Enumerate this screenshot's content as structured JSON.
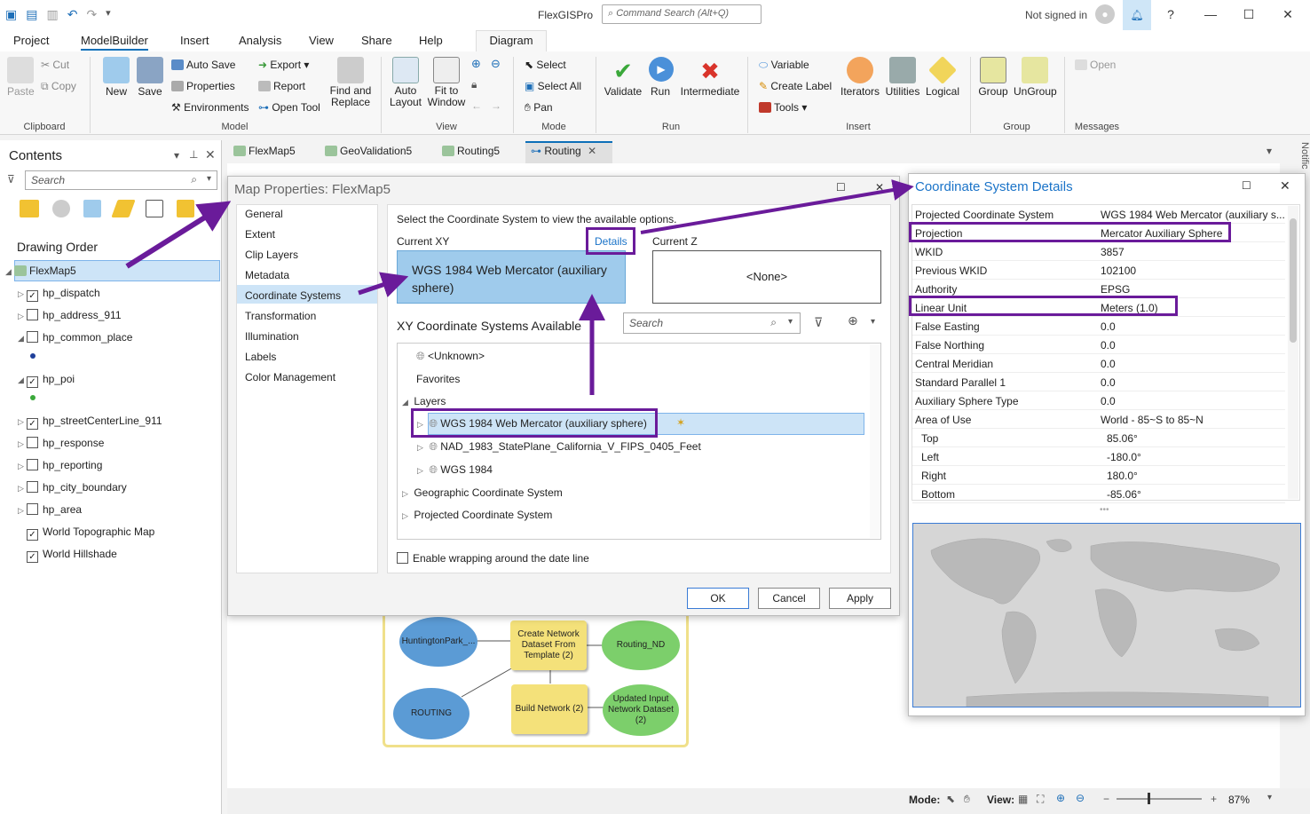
{
  "app": {
    "title": "FlexGISPro",
    "command_search_placeholder": "Command Search (Alt+Q)",
    "signin_text": "Not signed in",
    "help_glyph": "?"
  },
  "ribbon_tabs": [
    "Project",
    "ModelBuilder",
    "Insert",
    "Analysis",
    "View",
    "Share",
    "Help",
    "Diagram"
  ],
  "ribbon": {
    "clipboard": {
      "paste": "Paste",
      "cut": "Cut",
      "copy": "Copy",
      "label": "Clipboard"
    },
    "model": {
      "new": "New",
      "save": "Save",
      "auto_save": "Auto Save",
      "properties": "Properties",
      "environments": "Environments",
      "export": "Export",
      "report": "Report",
      "open_tool": "Open Tool",
      "find_replace": "Find and Replace",
      "label": "Model"
    },
    "view": {
      "auto_layout": "Auto Layout",
      "fit_window": "Fit to Window",
      "label": "View"
    },
    "mode": {
      "select": "Select",
      "select_all": "Select All",
      "pan": "Pan",
      "label": "Mode"
    },
    "run": {
      "validate": "Validate",
      "run": "Run",
      "intermediate": "Intermediate",
      "label": "Run"
    },
    "insert": {
      "variable": "Variable",
      "create_label": "Create Label",
      "tools": "Tools",
      "iterators": "Iterators",
      "utilities": "Utilities",
      "logical": "Logical",
      "label": "Insert"
    },
    "group": {
      "group": "Group",
      "ungroup": "UnGroup",
      "label": "Group"
    },
    "messages": {
      "open": "Open",
      "label": "Messages"
    }
  },
  "contents": {
    "title": "Contents",
    "search_placeholder": "Search",
    "drawing_order": "Drawing Order",
    "map_name": "FlexMap5",
    "layers": [
      {
        "name": "hp_dispatch",
        "checked": true
      },
      {
        "name": "hp_address_911",
        "checked": false
      },
      {
        "name": "hp_common_place",
        "checked": false
      },
      {
        "name": "hp_poi",
        "checked": true
      },
      {
        "name": "hp_streetCenterLine_911",
        "checked": true
      },
      {
        "name": "hp_response",
        "checked": false
      },
      {
        "name": "hp_reporting",
        "checked": false
      },
      {
        "name": "hp_city_boundary",
        "checked": false
      },
      {
        "name": "hp_area",
        "checked": false
      },
      {
        "name": "World Topographic Map",
        "checked": true
      },
      {
        "name": "World Hillshade",
        "checked": true
      }
    ]
  },
  "doc_tabs": [
    "FlexMap5",
    "GeoValidation5",
    "Routing5",
    "Routing"
  ],
  "map_properties": {
    "title": "Map Properties: FlexMap5",
    "nav": [
      "General",
      "Extent",
      "Clip Layers",
      "Metadata",
      "Coordinate Systems",
      "Transformation",
      "Illumination",
      "Labels",
      "Color Management"
    ],
    "selected_nav": "Coordinate Systems",
    "instruction": "Select the Coordinate System to view the available options.",
    "current_xy_label": "Current XY",
    "details_link": "Details",
    "current_z_label": "Current Z",
    "current_xy_value": "WGS 1984 Web Mercator (auxiliary sphere)",
    "current_z_value": "<None>",
    "available_heading": "XY Coordinate Systems Available",
    "search_placeholder": "Search",
    "tree": {
      "unknown": "<Unknown>",
      "favorites": "Favorites",
      "layers": "Layers",
      "layer_items": [
        "WGS 1984 Web Mercator (auxiliary sphere)",
        "NAD_1983_StatePlane_California_V_FIPS_0405_Feet",
        "WGS 1984"
      ],
      "geographic": "Geographic Coordinate System",
      "projected": "Projected Coordinate System"
    },
    "wrap_label": "Enable wrapping around the date line",
    "ok": "OK",
    "cancel": "Cancel",
    "apply": "Apply"
  },
  "csd": {
    "title": "Coordinate System Details",
    "rows": [
      {
        "k": "Projected Coordinate System",
        "v": "WGS 1984 Web Mercator (auxiliary s..."
      },
      {
        "k": "Projection",
        "v": "Mercator Auxiliary Sphere"
      },
      {
        "k": "WKID",
        "v": "3857"
      },
      {
        "k": "Previous WKID",
        "v": "102100"
      },
      {
        "k": "Authority",
        "v": "EPSG"
      },
      {
        "k": "Linear Unit",
        "v": "Meters (1.0)"
      },
      {
        "k": "False Easting",
        "v": "0.0"
      },
      {
        "k": "False Northing",
        "v": "0.0"
      },
      {
        "k": "Central Meridian",
        "v": "0.0"
      },
      {
        "k": "Standard Parallel 1",
        "v": "0.0"
      },
      {
        "k": "Auxiliary Sphere Type",
        "v": "0.0"
      },
      {
        "k": "Area of Use",
        "v": "World - 85~S to 85~N"
      },
      {
        "k": "Top",
        "v": "85.06°"
      },
      {
        "k": "Left",
        "v": "-180.0°"
      },
      {
        "k": "Right",
        "v": "180.0°"
      },
      {
        "k": "Bottom",
        "v": "-85.06°"
      }
    ]
  },
  "model_nodes": {
    "huntington": "HuntingtonPark_...",
    "routing": "ROUTING",
    "create_nd": "Create Network Dataset From Template (2)",
    "routing_nd": "Routing_ND",
    "build_network": "Build Network (2)",
    "updated_input": "Updated Input Network Dataset (2)"
  },
  "status": {
    "mode_label": "Mode:",
    "view_label": "View:",
    "zoom": "87%"
  },
  "side_label": "Notific",
  "colors": {
    "accent": "#1a73c8",
    "highlight": "#6a1b9a",
    "selection": "#cde4f7"
  }
}
